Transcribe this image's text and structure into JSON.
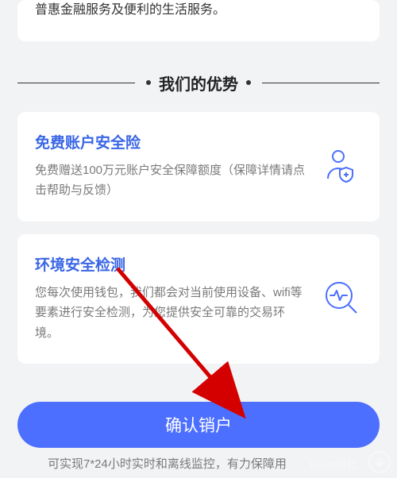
{
  "intro_tail": "普惠金融服务及便利的生活服务。",
  "section_title": "我们的优势",
  "features": [
    {
      "title": "免费账户安全险",
      "desc": "免费赠送100万元账户安全保障额度（保障详情请点击帮助与反馈）"
    },
    {
      "title": "环境安全检测",
      "desc": "您每次使用钱包，我们都会对当前使用设备、wifi等要素进行安全检测，为您提供安全可靠的交易环境。"
    }
  ],
  "confirm_label": "确认销户",
  "bottom_peek": "可实现7*24小时实时和离线监控，有力保障用",
  "watermark": "Baidu经验"
}
